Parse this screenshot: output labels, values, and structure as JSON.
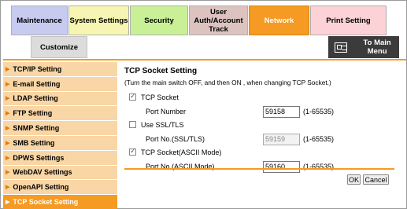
{
  "tabs": {
    "maintenance": "Maintenance",
    "system_settings": "System Settings",
    "security": "Security",
    "user_auth": "User Auth/Account Track",
    "network": "Network",
    "print_setting": "Print Setting",
    "customize": "Customize"
  },
  "to_main_menu": "To Main Menu",
  "sidebar": {
    "items": [
      {
        "label": "TCP/IP Setting"
      },
      {
        "label": "E-mail Setting"
      },
      {
        "label": "LDAP Setting"
      },
      {
        "label": "FTP Setting"
      },
      {
        "label": "SNMP Setting"
      },
      {
        "label": "SMB Setting"
      },
      {
        "label": "DPWS Settings"
      },
      {
        "label": "WebDAV Settings"
      },
      {
        "label": "OpenAPI Setting"
      },
      {
        "label": "TCP Socket Setting"
      }
    ],
    "active_index": 9
  },
  "content": {
    "title": "TCP Socket Setting",
    "note": "(Turn the main switch OFF, and then ON , when changing TCP Socket.)",
    "tcp_socket": {
      "label": "TCP Socket",
      "checked": true
    },
    "port_number": {
      "label": "Port Number",
      "value": "59158",
      "range": "(1-65535)"
    },
    "use_ssl": {
      "label": "Use SSL/TLS",
      "checked": false
    },
    "port_ssl": {
      "label": "Port No.(SSL/TLS)",
      "value": "59159",
      "range": "(1-65535)"
    },
    "tcp_socket_ascii": {
      "label": "TCP Socket(ASCII Mode)",
      "checked": true
    },
    "port_ascii": {
      "label": "Port No.(ASCII Mode)",
      "value": "59160",
      "range": "(1-65535)"
    }
  },
  "buttons": {
    "ok": "OK",
    "cancel": "Cancel"
  },
  "colors": {
    "accent": "#f59a22",
    "sidebar_item": "#f9d6a5"
  }
}
